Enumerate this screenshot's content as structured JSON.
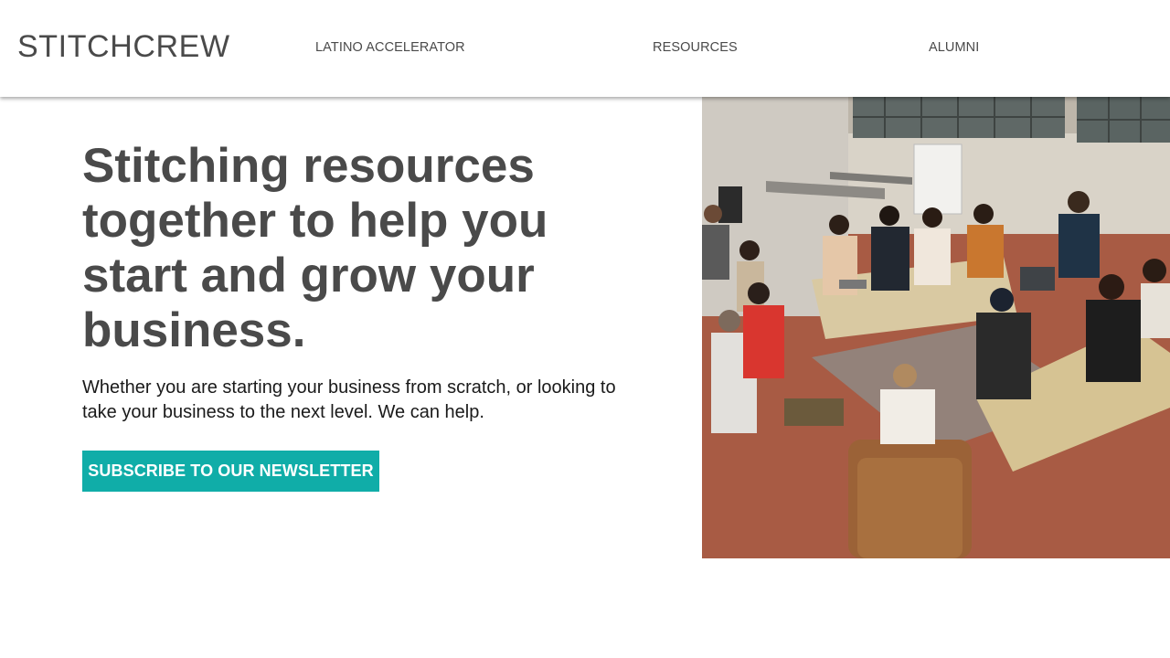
{
  "header": {
    "brand": "STITCHCREW",
    "nav": [
      {
        "label": "LATINO ACCELERATOR"
      },
      {
        "label": "RESOURCES"
      },
      {
        "label": "ALUMNI"
      }
    ]
  },
  "hero": {
    "title": "Stitching resources together to help you start and grow your business.",
    "subtitle": "Whether you are starting your business from scratch, or looking to take your business to the next level. We can help.",
    "cta_label": "SUBSCRIBE TO OUR NEWSLETTER",
    "image_icon": "group-meeting-photo"
  },
  "colors": {
    "accent": "#10ada8",
    "text": "#4a4a4a",
    "background": "#ffffff"
  }
}
